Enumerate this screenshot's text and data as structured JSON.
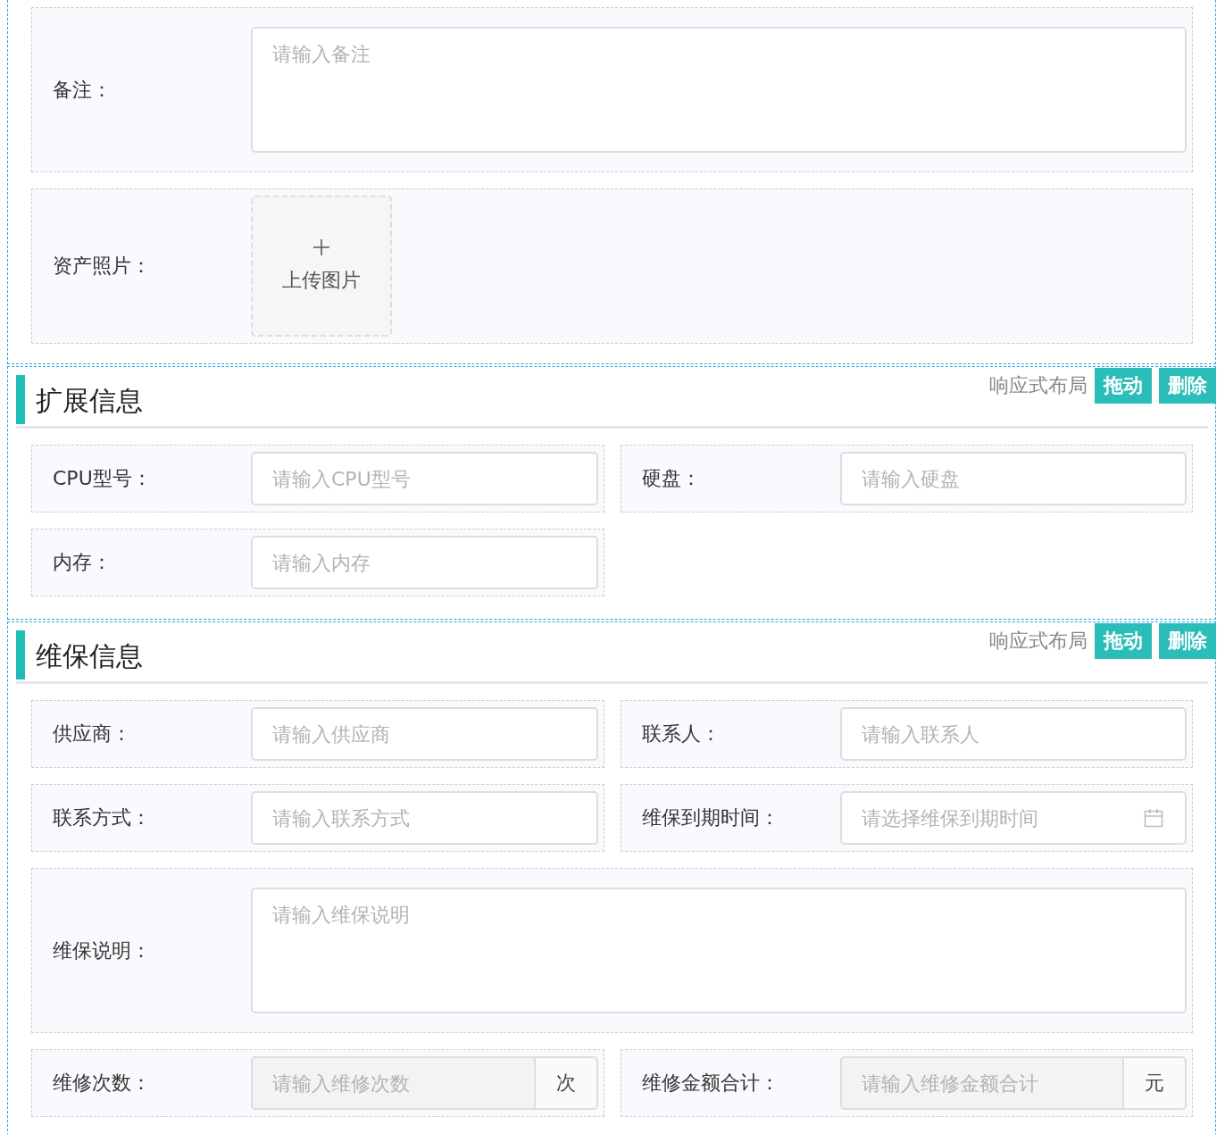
{
  "sections": [
    {
      "items": [
        {
          "kind": "textarea",
          "label": "备注：",
          "placeholder": "请输入备注",
          "full": true
        },
        {
          "kind": "upload",
          "label": "资产照片：",
          "button_text": "上传图片",
          "full": true
        }
      ]
    },
    {
      "title": "扩展信息",
      "layout_label": "响应式布局",
      "buttons": [
        "拖动",
        "删除"
      ],
      "items": [
        {
          "kind": "input",
          "label": "CPU型号：",
          "placeholder": "请输入CPU型号",
          "full": false
        },
        {
          "kind": "input",
          "label": "硬盘：",
          "placeholder": "请输入硬盘",
          "full": false
        },
        {
          "kind": "input",
          "label": "内存：",
          "placeholder": "请输入内存",
          "full": false
        }
      ]
    },
    {
      "title": "维保信息",
      "layout_label": "响应式布局",
      "buttons": [
        "拖动",
        "删除"
      ],
      "items": [
        {
          "kind": "input",
          "label": "供应商：",
          "placeholder": "请输入供应商",
          "full": false
        },
        {
          "kind": "input",
          "label": "联系人：",
          "placeholder": "请输入联系人",
          "full": false
        },
        {
          "kind": "input",
          "label": "联系方式：",
          "placeholder": "请输入联系方式",
          "full": false
        },
        {
          "kind": "date",
          "label": "维保到期时间：",
          "placeholder": "请选择维保到期时间",
          "full": false
        },
        {
          "kind": "textarea",
          "label": "维保说明：",
          "placeholder": "请输入维保说明",
          "full": true
        },
        {
          "kind": "append",
          "label": "维修次数：",
          "placeholder": "请输入维修次数",
          "suffix": "次",
          "disabled": true,
          "full": false
        },
        {
          "kind": "append",
          "label": "维修金额合计：",
          "placeholder": "请输入维修金额合计",
          "suffix": "元",
          "disabled": true,
          "full": false
        }
      ]
    }
  ]
}
